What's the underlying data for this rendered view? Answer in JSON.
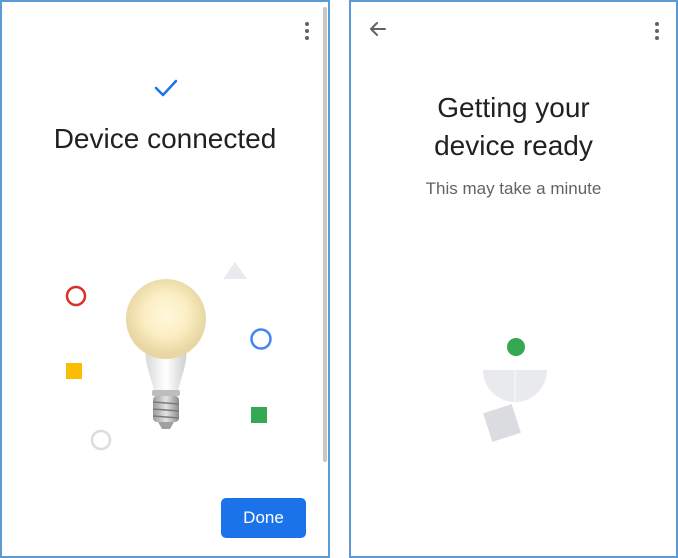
{
  "left_screen": {
    "title": "Device connected",
    "done_label": "Done",
    "icons": {
      "menu": "more-vertical-icon",
      "check": "checkmark-icon",
      "illustration": "light-bulb-illustration"
    },
    "colors": {
      "accent": "#1a73e8",
      "red": "#d93025",
      "yellow": "#fbbc04",
      "blue": "#4285f4",
      "green": "#34a853",
      "gray": "#dadce0"
    }
  },
  "right_screen": {
    "title_line1": "Getting your",
    "title_line2": "device ready",
    "subtitle": "This may take a minute",
    "icons": {
      "back": "back-arrow-icon",
      "menu": "more-vertical-icon",
      "loading": "loading-animation"
    },
    "colors": {
      "dot": "#34a853",
      "shapes": "#e8eaed"
    }
  }
}
